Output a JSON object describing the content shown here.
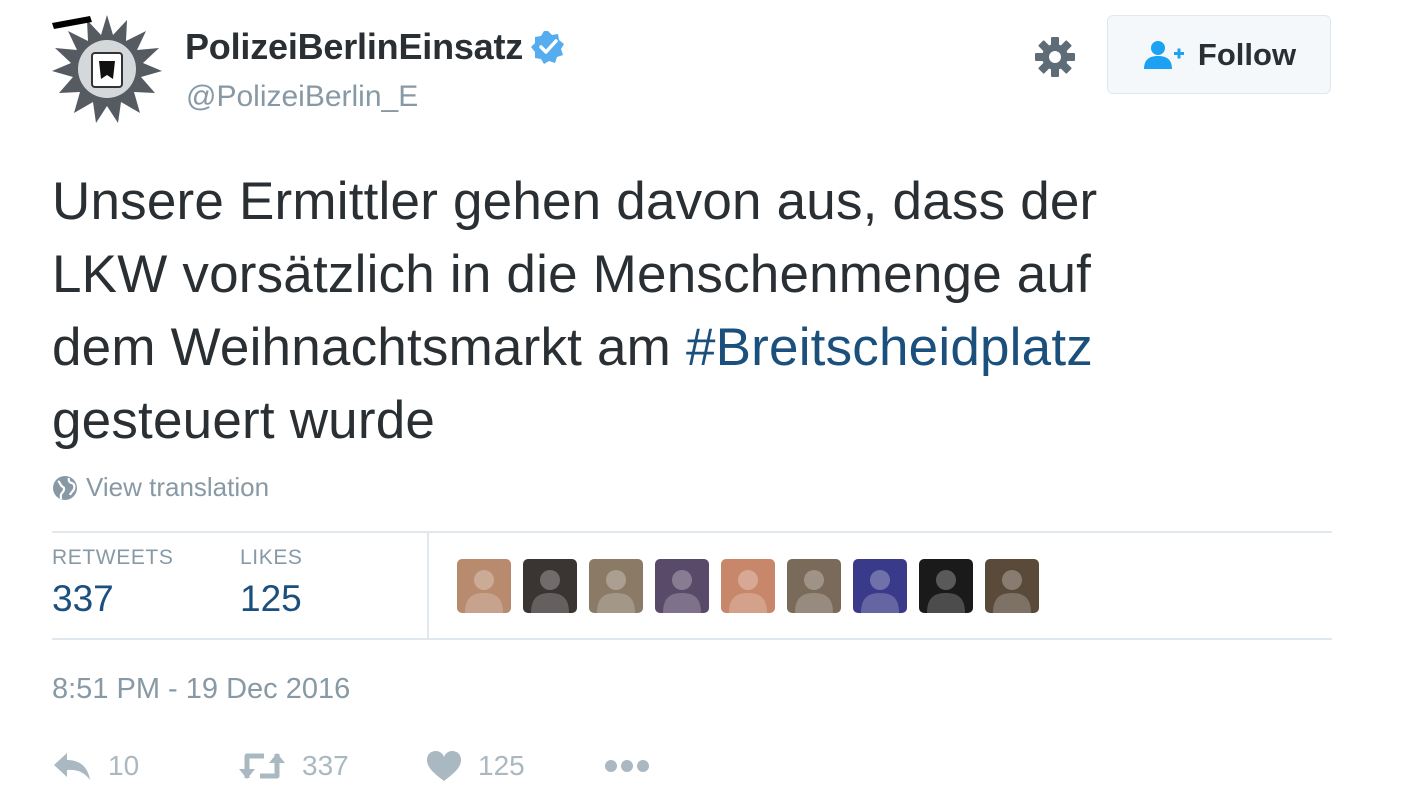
{
  "user": {
    "display_name": "PolizeiBerlinEinsatz",
    "handle": "@PolizeiBerlin_E",
    "verified": true,
    "avatar_icon": "police-star-badge-icon"
  },
  "header": {
    "follow_label": "Follow",
    "settings_icon": "gear-icon"
  },
  "tweet": {
    "text_lines": [
      "Unsere Ermittler gehen davon aus, dass der",
      "LKW vorsätzlich in die Menschenmenge auf",
      "dem Weihnachtsmarkt am "
    ],
    "hashtag": "#Breitscheidplatz",
    "text_last_line": "gesteuert wurde",
    "translation_label": "View translation"
  },
  "stats": {
    "retweets_label": "RETWEETS",
    "retweets_value": "337",
    "likes_label": "LIKES",
    "likes_value": "125"
  },
  "likers": [
    {
      "icon": "user-avatar-icon",
      "color": "#b88a6e"
    },
    {
      "icon": "user-avatar-icon",
      "color": "#3a3432"
    },
    {
      "icon": "user-avatar-icon",
      "color": "#8a7a66"
    },
    {
      "icon": "user-avatar-icon",
      "color": "#5a4a6a"
    },
    {
      "icon": "user-avatar-icon",
      "color": "#c8876a"
    },
    {
      "icon": "user-avatar-icon",
      "color": "#7a6a5a"
    },
    {
      "icon": "user-avatar-icon",
      "color": "#3a3a8a"
    },
    {
      "icon": "user-avatar-icon",
      "color": "#1a1a1a"
    },
    {
      "icon": "user-avatar-icon",
      "color": "#5a4a3a"
    }
  ],
  "timestamp": "8:51 PM - 19 Dec 2016",
  "actions": {
    "reply_count": "10",
    "retweet_count": "337",
    "like_count": "125",
    "reply_icon": "reply-icon",
    "retweet_icon": "retweet-icon",
    "like_icon": "heart-icon",
    "more_icon": "more-dots-icon"
  },
  "colors": {
    "text": "#292f33",
    "muted": "#8899a6",
    "link": "#1b4f7c",
    "verified": "#55acee",
    "follow_icon": "#1da1f2",
    "action_icon": "#aab8c2",
    "border": "#e1e8ed"
  }
}
